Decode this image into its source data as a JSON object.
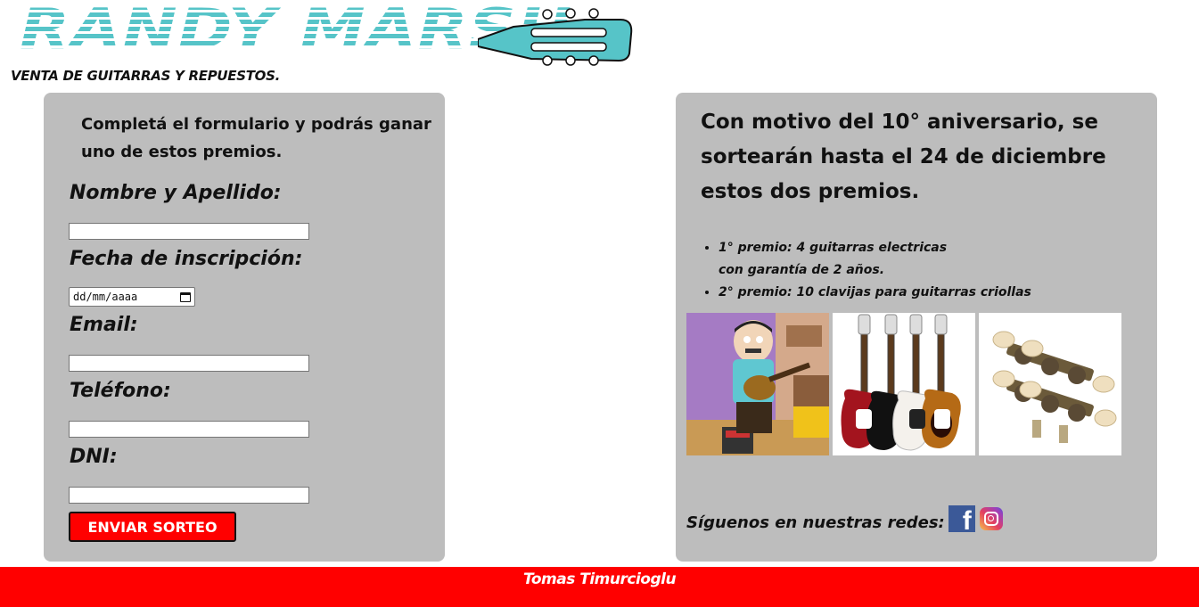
{
  "header": {
    "brand": "RANDY MARSH",
    "tagline": "VENTA DE GUITARRAS Y REPUESTOS."
  },
  "form": {
    "intro": "Completá el formulario y podrás ganar uno de estos premios.",
    "fields": {
      "name_label": "Nombre y Apellido:",
      "date_label": "Fecha de inscripción:",
      "date_placeholder": "dd/mm/aaaa",
      "email_label": "Email:",
      "phone_label": "Teléfono:",
      "dni_label": "DNI:"
    },
    "submit_label": "ENVIAR SORTEO"
  },
  "promo": {
    "announcement": "Con motivo del 10° aniversario, se sortearán hasta el 24 de diciembre estos dos premios.",
    "prize1_line1": "1° premio: 4 guitarras electricas",
    "prize1_line2": "con garantía de 2 años.",
    "prize2": "2° premio: 10 clavijas para guitarras criollas"
  },
  "social": {
    "label": "Síguenos en nuestras redes:",
    "icons": [
      "facebook-icon",
      "instagram-icon"
    ]
  },
  "footer": {
    "author": "Tomas Timurcioglu"
  },
  "colors": {
    "brand_teal": "#56c4c8",
    "panel_gray": "#bdbdbd",
    "footer_red": "#ff0000",
    "button_red": "#ff0000"
  }
}
